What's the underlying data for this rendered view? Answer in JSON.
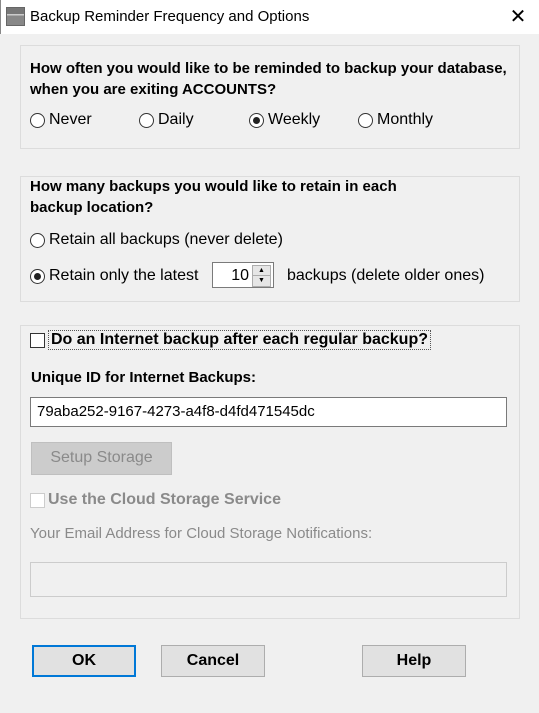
{
  "window": {
    "title": "Backup Reminder Frequency and Options",
    "close_icon": "close-icon",
    "app_icon": "calculator-icon"
  },
  "frequency": {
    "question": "How often you would like to be reminded to backup your database, when you are exiting ACCOUNTS?",
    "options": [
      {
        "label": "Never",
        "selected": false
      },
      {
        "label": "Daily",
        "selected": false
      },
      {
        "label": "Weekly",
        "selected": true
      },
      {
        "label": "Monthly",
        "selected": false
      }
    ]
  },
  "retain": {
    "question": "How many backups you would like to retain in each backup location?",
    "all_label": "Retain all backups (never delete)",
    "latest_label": "Retain only the latest",
    "count": "10",
    "suffix": "backups (delete older ones)",
    "selected": "latest"
  },
  "internet": {
    "checkbox_label": "Do an Internet backup after each regular backup?",
    "checked": false,
    "uid_label": "Unique ID for Internet Backups:",
    "uid_value": "79aba252-9167-4273-a4f8-d4fd471545dc",
    "setup_button": "Setup Storage",
    "cloud_label": "Use the Cloud Storage Service",
    "email_label": "Your Email Address for Cloud Storage Notifications:",
    "email_value": ""
  },
  "buttons": {
    "ok": "OK",
    "cancel": "Cancel",
    "help": "Help"
  },
  "colors": {
    "focus_border": "#0078d7",
    "disabled_text": "#8a8a8a"
  }
}
